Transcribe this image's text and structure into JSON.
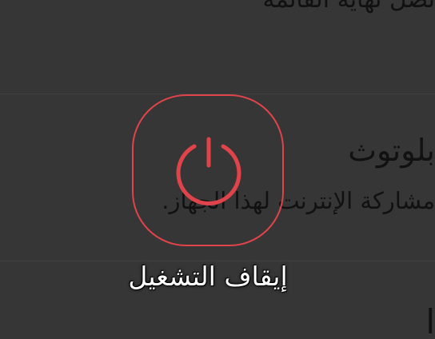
{
  "background_items": {
    "top_partial": "تصل نهاية القائمة",
    "bluetooth_title": "بلوتوث",
    "bluetooth_subtitle": "مشاركة الإنترنت لهذا الجهاز.",
    "bottom_partial": "ا"
  },
  "power_overlay": {
    "label": "إيقاف التشغيل",
    "icon": "power-icon",
    "accent_color": "#e0444a"
  }
}
